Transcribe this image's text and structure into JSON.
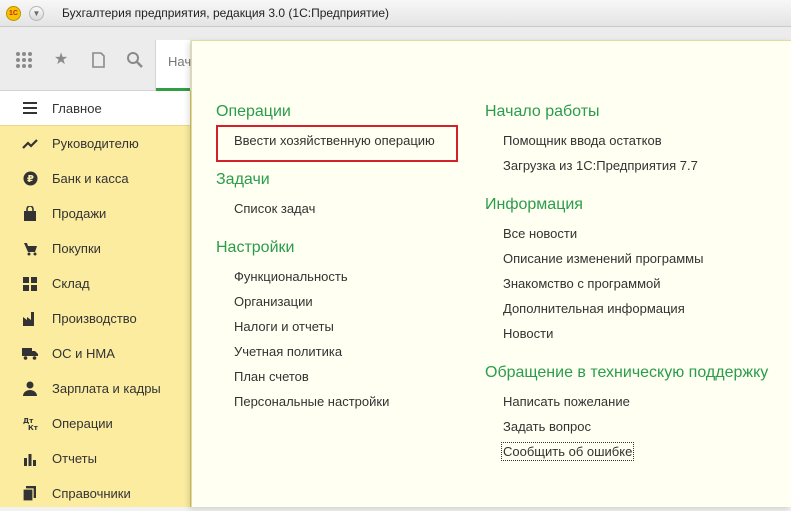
{
  "window": {
    "title": "Бухгалтерия предприятия, редакция 3.0  (1С:Предприятие)",
    "logo_text": "1С"
  },
  "toolbar": {
    "home_tab_label": "Нач"
  },
  "sidebar": {
    "items": [
      {
        "label": "Главное",
        "icon": "hamburger-icon",
        "active": true
      },
      {
        "label": "Руководителю",
        "icon": "trend-icon"
      },
      {
        "label": "Банк и касса",
        "icon": "ruble-icon"
      },
      {
        "label": "Продажи",
        "icon": "shopping-bag-icon"
      },
      {
        "label": "Покупки",
        "icon": "cart-icon"
      },
      {
        "label": "Склад",
        "icon": "warehouse-icon"
      },
      {
        "label": "Производство",
        "icon": "factory-icon"
      },
      {
        "label": "ОС и НМА",
        "icon": "truck-icon"
      },
      {
        "label": "Зарплата и кадры",
        "icon": "person-icon"
      },
      {
        "label": "Операции",
        "icon": "debit-credit-icon"
      },
      {
        "label": "Отчеты",
        "icon": "bar-chart-icon"
      },
      {
        "label": "Справочники",
        "icon": "books-icon"
      }
    ]
  },
  "panel": {
    "left": {
      "operations": {
        "title": "Операции",
        "links": [
          "Ввести хозяйственную операцию"
        ]
      },
      "tasks": {
        "title": "Задачи",
        "links": [
          "Список задач"
        ]
      },
      "settings": {
        "title": "Настройки",
        "links": [
          "Функциональность",
          "Организации",
          "Налоги и отчеты",
          "Учетная политика",
          "План счетов",
          "Персональные настройки"
        ]
      }
    },
    "right": {
      "start": {
        "title": "Начало работы",
        "links": [
          "Помощник ввода остатков",
          "Загрузка из 1С:Предприятия 7.7"
        ]
      },
      "info": {
        "title": "Информация",
        "links": [
          "Все новости",
          "Описание изменений программы",
          "Знакомство с программой",
          "Дополнительная информация",
          "Новости"
        ]
      },
      "support": {
        "title": "Обращение в техническую поддержку",
        "links": [
          "Написать пожелание",
          "Задать вопрос",
          "Сообщить об ошибке"
        ]
      }
    }
  },
  "colors": {
    "accent_green": "#2a9d4b",
    "sidebar_bg": "#fbeca0",
    "panel_bg": "#fffff2",
    "highlight_red": "#d4202b"
  }
}
